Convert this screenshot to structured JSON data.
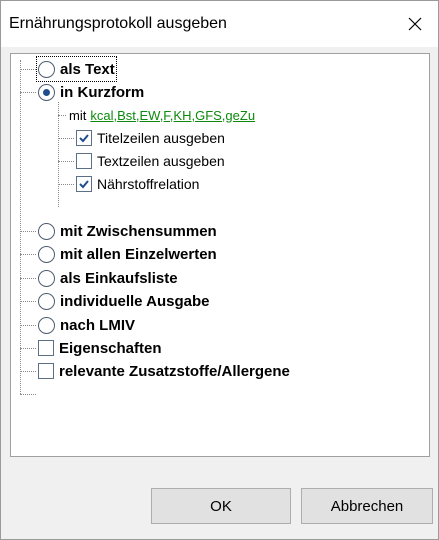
{
  "window": {
    "title": "Ernährungsprotokoll ausgeben",
    "close_icon": "close-icon"
  },
  "options": [
    {
      "label": "als Text",
      "type": "radio",
      "checked": false
    },
    {
      "label": "in Kurzform",
      "type": "radio",
      "checked": true
    },
    {
      "label": "mit Zwischensummen",
      "type": "radio",
      "checked": false
    },
    {
      "label": "mit allen Einzelwerten",
      "type": "radio",
      "checked": false
    },
    {
      "label": "als Einkaufsliste",
      "type": "radio",
      "checked": false
    },
    {
      "label": "individuelle Ausgabe",
      "type": "radio",
      "checked": false
    },
    {
      "label": "nach LMIV",
      "type": "radio",
      "checked": false
    },
    {
      "label": "Eigenschaften",
      "type": "checkbox",
      "checked": false
    },
    {
      "label": "relevante Zusatzstoffe/Allergene",
      "type": "checkbox",
      "checked": false
    }
  ],
  "kurzform": {
    "mit_prefix": "mit",
    "mit_link": "kcal,Bst,EW,F,KH,GFS,geZu",
    "suboptions": [
      {
        "label": "Titelzeilen ausgeben",
        "checked": true
      },
      {
        "label": "Textzeilen ausgeben",
        "checked": false
      },
      {
        "label": "Nährstoffrelation",
        "checked": true
      }
    ]
  },
  "buttons": {
    "ok": "OK",
    "cancel": "Abbrechen"
  },
  "colors": {
    "link": "#0d8a0d",
    "check": "#1f4e8a"
  }
}
